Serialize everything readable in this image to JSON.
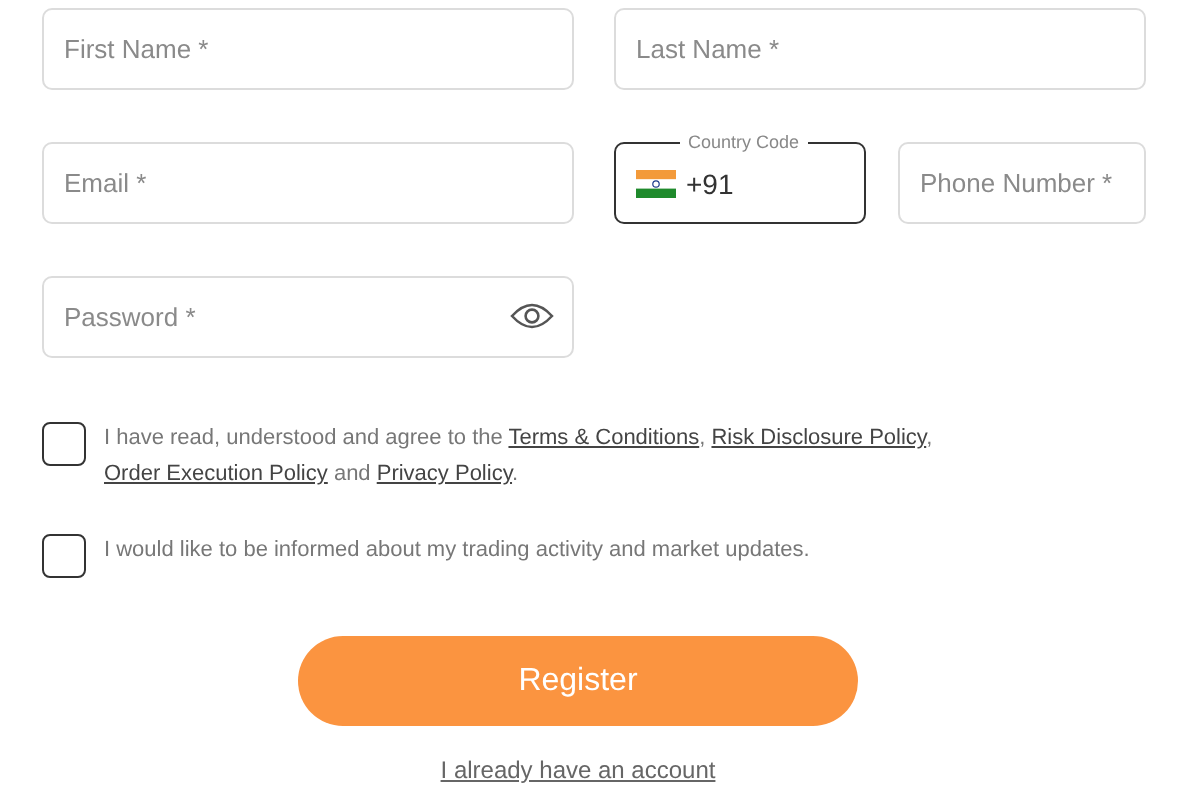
{
  "fields": [
    {
      "kind": "text",
      "placeholder": "First Name *"
    },
    {
      "kind": "text",
      "placeholder": "Last Name *"
    },
    {
      "kind": "text",
      "placeholder": "Email *"
    },
    {
      "kind": "country",
      "label": "Country Code",
      "value": "+91"
    },
    {
      "kind": "text",
      "placeholder": "Phone Number *"
    },
    {
      "kind": "password",
      "placeholder": "Password *"
    }
  ],
  "consents": [
    {
      "checked": false,
      "segments": [
        {
          "kind": "text",
          "text": "I have read, understood and agree to the "
        },
        {
          "kind": "link",
          "text": "Terms & Conditions"
        },
        {
          "kind": "text",
          "text": ", "
        },
        {
          "kind": "link",
          "text": "Risk Disclosure Policy"
        },
        {
          "kind": "text",
          "text": ", "
        },
        {
          "kind": "link",
          "text": "Order Execution Policy"
        },
        {
          "kind": "text",
          "text": " and "
        },
        {
          "kind": "link",
          "text": "Privacy Policy"
        },
        {
          "kind": "text",
          "text": "."
        }
      ]
    },
    {
      "checked": false,
      "segments": [
        {
          "kind": "text",
          "text": "I would like to be informed about my trading activity and market updates."
        }
      ]
    }
  ],
  "register_button": "Register",
  "login_link": "I already have an account"
}
